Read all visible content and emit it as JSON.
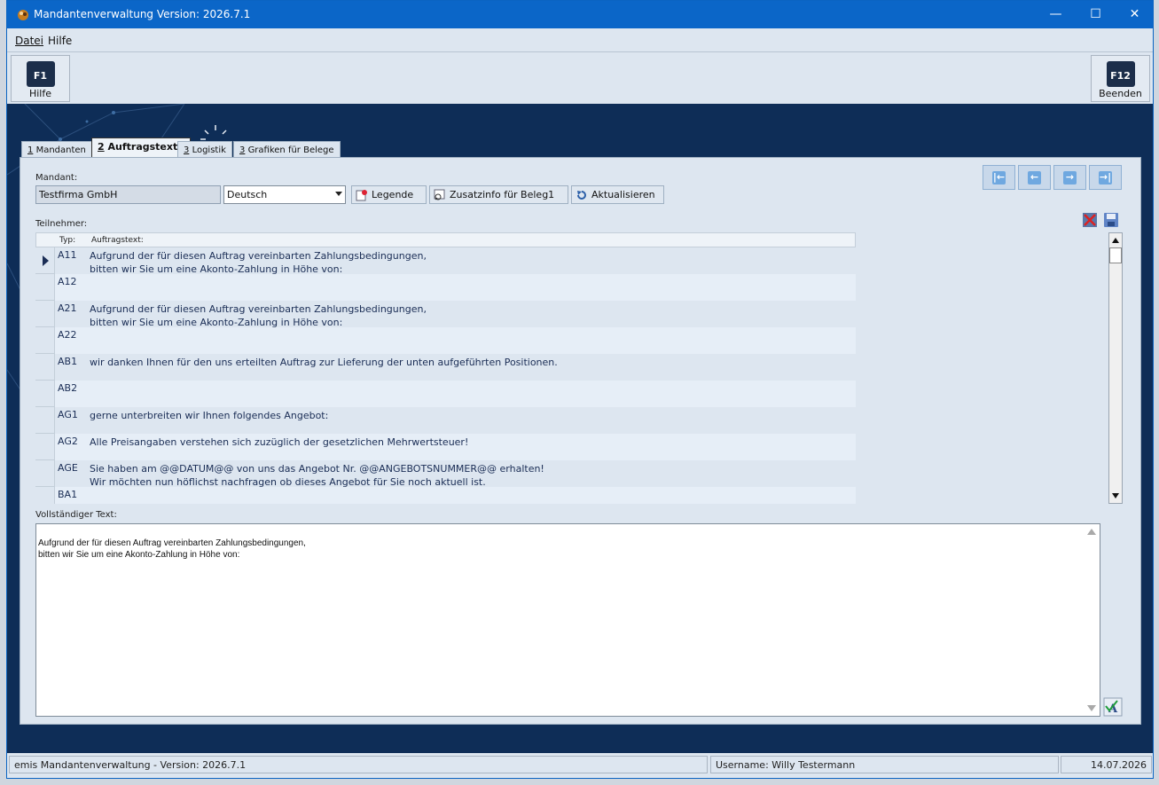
{
  "window": {
    "title": "Mandantenverwaltung Version: 2026.7.1",
    "minimize": "—",
    "maximize": "☐",
    "close": "✕"
  },
  "menu": {
    "file": "Datei",
    "help": "Hilfe"
  },
  "toolbar": {
    "help_key": "F1",
    "help_label": "Hilfe",
    "exit_key": "F12",
    "exit_label": "Beenden"
  },
  "tabs": [
    {
      "number": "1",
      "label": "Mandanten"
    },
    {
      "number": "2",
      "label": "Auftragstexte"
    },
    {
      "number": "3",
      "label": "Logistik"
    },
    {
      "number": "3",
      "label": "Grafiken für Belege"
    }
  ],
  "form": {
    "mandant_label": "Mandant:",
    "mandant_value": "Testfirma GmbH",
    "language_value": "Deutsch",
    "legend_button": "Legende",
    "zusatzinfo_button": "Zusatzinfo für Beleg1",
    "refresh_button": "Aktualisieren",
    "participants_label": "Teilnehmer:",
    "fulltext_label": "Vollständiger Text:"
  },
  "nav": {
    "first": "|←",
    "prev": "←",
    "next": "→",
    "last": "→|"
  },
  "grid": {
    "headers": {
      "typ": "Typ:",
      "text": "Auftragstext:"
    },
    "rows": [
      {
        "typ": "A11",
        "text": "Aufgrund der für diesen Auftrag vereinbarten Zahlungsbedingungen,\nbitten wir Sie um eine Akonto-Zahlung in Höhe von:"
      },
      {
        "typ": "A12",
        "text": ""
      },
      {
        "typ": "A21",
        "text": "Aufgrund der für diesen Auftrag vereinbarten Zahlungsbedingungen,\nbitten wir Sie um eine Akonto-Zahlung in Höhe von:"
      },
      {
        "typ": "A22",
        "text": ""
      },
      {
        "typ": "AB1",
        "text": "wir danken Ihnen für den uns erteilten Auftrag zur Lieferung der unten aufgeführten Positionen."
      },
      {
        "typ": "AB2",
        "text": ""
      },
      {
        "typ": "AG1",
        "text": "gerne unterbreiten wir Ihnen folgendes Angebot:"
      },
      {
        "typ": "AG2",
        "text": "Alle Preisangaben verstehen sich zuzüglich der gesetzlichen Mehrwertsteuer!"
      },
      {
        "typ": "AGE",
        "text": "Sie haben am @@DATUM@@ von uns das Angebot Nr. @@ANGEBOTSNUMMER@@ erhalten!\nWir möchten nun höflichst nachfragen ob dieses Angebot für Sie noch aktuell ist."
      },
      {
        "typ": "BA1",
        "text": ""
      }
    ]
  },
  "fulltext": {
    "value": "Aufgrund der für diesen Auftrag vereinbarten Zahlungsbedingungen,\nbitten wir Sie um eine Akonto-Zahlung in Höhe von:"
  },
  "status": {
    "app": "emis Mandantenverwaltung - Version: 2026.7.1",
    "user": "Username: Willy Testermann",
    "date": "14.07.2026"
  }
}
